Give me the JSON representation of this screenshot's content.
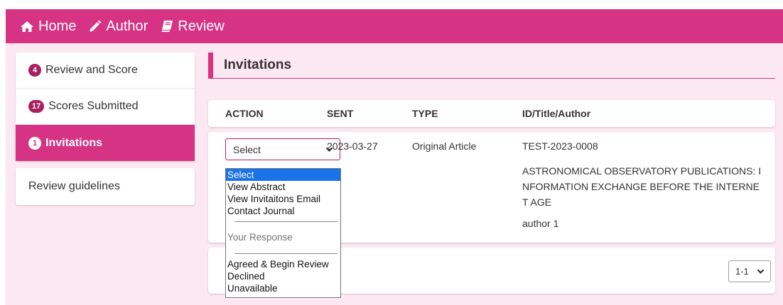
{
  "nav": {
    "home": "Home",
    "author": "Author",
    "review": "Review"
  },
  "sidebar": {
    "items": [
      {
        "badge": "4",
        "label": "Review and Score"
      },
      {
        "badge": "17",
        "label": "Scores Submitted"
      },
      {
        "badge": "1",
        "label": "Invitations"
      }
    ],
    "guidelines": "Review guidelines"
  },
  "page_title": "Invitations",
  "table": {
    "headers": [
      "ACTION",
      "SENT",
      "TYPE",
      "ID/Title/Author"
    ],
    "row": {
      "action_selected": "Select",
      "sent": "2023-03-27",
      "type": "Original Article",
      "id": "TEST-2023-0008",
      "title_lines": [
        "ASTRONOMICAL OBSERVATORY PUBLICATIONS: I",
        "NFORMATION EXCHANGE BEFORE THE INTERNE",
        "T AGE"
      ],
      "author": "author 1"
    }
  },
  "dropdown": {
    "options": [
      "Select",
      "View Abstract",
      "View Invitaitons Email",
      "Contact Journal"
    ],
    "group_label": "Your Response",
    "response_options": [
      "Agreed & Begin Review",
      "Declined",
      "Unavailable"
    ]
  },
  "pager": {
    "value": "1-1"
  },
  "colors": {
    "accent": "#d63384",
    "background": "#fce8f1"
  }
}
